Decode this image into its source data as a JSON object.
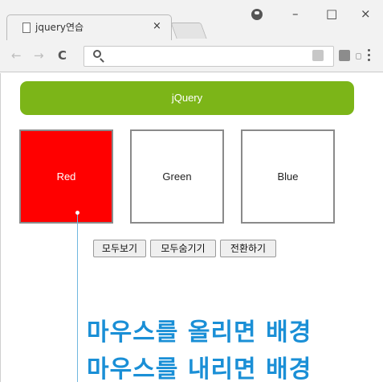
{
  "browser": {
    "tab_title": "jquery연습",
    "tab_close": "×",
    "window_minimize": "–",
    "window_maximize": "□",
    "window_close": "×",
    "nav_back": "←",
    "nav_forward": "→",
    "nav_reload": "C",
    "address": ""
  },
  "page": {
    "header": "jQuery",
    "boxes": [
      {
        "label": "Red",
        "color": "#ff0000"
      },
      {
        "label": "Green",
        "color": "#ffffff"
      },
      {
        "label": "Blue",
        "color": "#ffffff"
      }
    ],
    "buttons": {
      "show_all": "모두보기",
      "hide_all": "모두숨기기",
      "toggle": "전환하기"
    }
  },
  "overlay": {
    "caption_line1": "마우스를 올리면 배경",
    "caption_line2": "마우스를 내리면 배경"
  },
  "colors": {
    "header_bg": "#7cb518",
    "caption": "#1a8fd6",
    "red_box": "#ff0000"
  }
}
